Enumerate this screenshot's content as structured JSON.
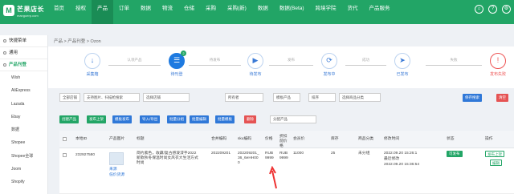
{
  "brand": {
    "name": "芒果店长",
    "sub": "mangoerp.com",
    "mark": "M"
  },
  "nav": [
    "首页",
    "授权",
    "产品",
    "订单",
    "数据",
    "物流",
    "仓储",
    "采购",
    "采购(新)",
    "数据",
    "数据(Beta)",
    "跨境学院",
    "货代",
    "产品服务"
  ],
  "sidebar": {
    "groups": [
      {
        "label": "快捷菜单"
      },
      {
        "label": "通用"
      },
      {
        "label": "产品刊登"
      }
    ],
    "items": [
      "Wish",
      "AliExpress",
      "Lazada",
      "Ebay",
      "数据",
      "Shopee",
      "Shopee全球",
      "Joom",
      "Shopify"
    ]
  },
  "breadcrumb": "产品 > 产品刊登 > Ozon",
  "steps": [
    {
      "label": "采集箱",
      "icon": "↓"
    },
    {
      "label": "待刊登",
      "icon": "☰",
      "badge": "2"
    },
    {
      "label": "待发布",
      "icon": "▶"
    },
    {
      "label": "发布中",
      "icon": "⟳"
    },
    {
      "label": "已发布",
      "icon": "➤"
    },
    {
      "label": "发布失败",
      "icon": "!"
    }
  ],
  "arrows": [
    "认领产品",
    "待发布",
    "发布",
    "成功",
    "失败"
  ],
  "filters": [
    "全部店铺",
    "支持图片、扫描枪搜索",
    "选择店铺",
    "所有者",
    "模板产品",
    "排序",
    "选择商品分类"
  ],
  "filter_btns": {
    "search": "保存搜索",
    "clear": "清空"
  },
  "buttons": [
    {
      "label": "创建产品",
      "color": "#22a566"
    },
    {
      "label": "发布上架",
      "color": "#22a566"
    },
    {
      "label": "模板发布",
      "color": "#2f78d8"
    },
    {
      "label": "导入/导出",
      "color": "#2f78d8"
    },
    {
      "label": "批量分组",
      "color": "#2f78d8"
    },
    {
      "label": "批量编辑",
      "color": "#2f78d8"
    },
    {
      "label": "批量模板",
      "color": "#2f78d8"
    },
    {
      "label": "删除",
      "color": "#e55353"
    }
  ],
  "group_select": "分配产品",
  "columns": [
    "本地ID",
    "产品图片",
    "标题",
    "合并编码",
    "sku编码",
    "价格",
    "折扣前价格",
    "会员价",
    "库存",
    "商品分类",
    "修改时间",
    "状态",
    "操作"
  ],
  "row": {
    "id": "232927580",
    "image_link": "来源",
    "image_link2": "低价货源",
    "title": "简约素色，收藏/复古感泼漆手2022新款秋冬保温时尚女风衣大生活方式时尚",
    "merge_code": "202209201",
    "sku": "202209201_36_6eHH000",
    "price": "RUB 9999",
    "discount_price": "RUB 9999",
    "member_price": "11000",
    "stock": "25",
    "category": "未分组",
    "time1": "2022.09.20 15:26:1",
    "time2": "最近修改",
    "time3": "2022.09.20 15:36:54",
    "status": "可发布",
    "op1": "发布上架",
    "op2": "编辑"
  }
}
